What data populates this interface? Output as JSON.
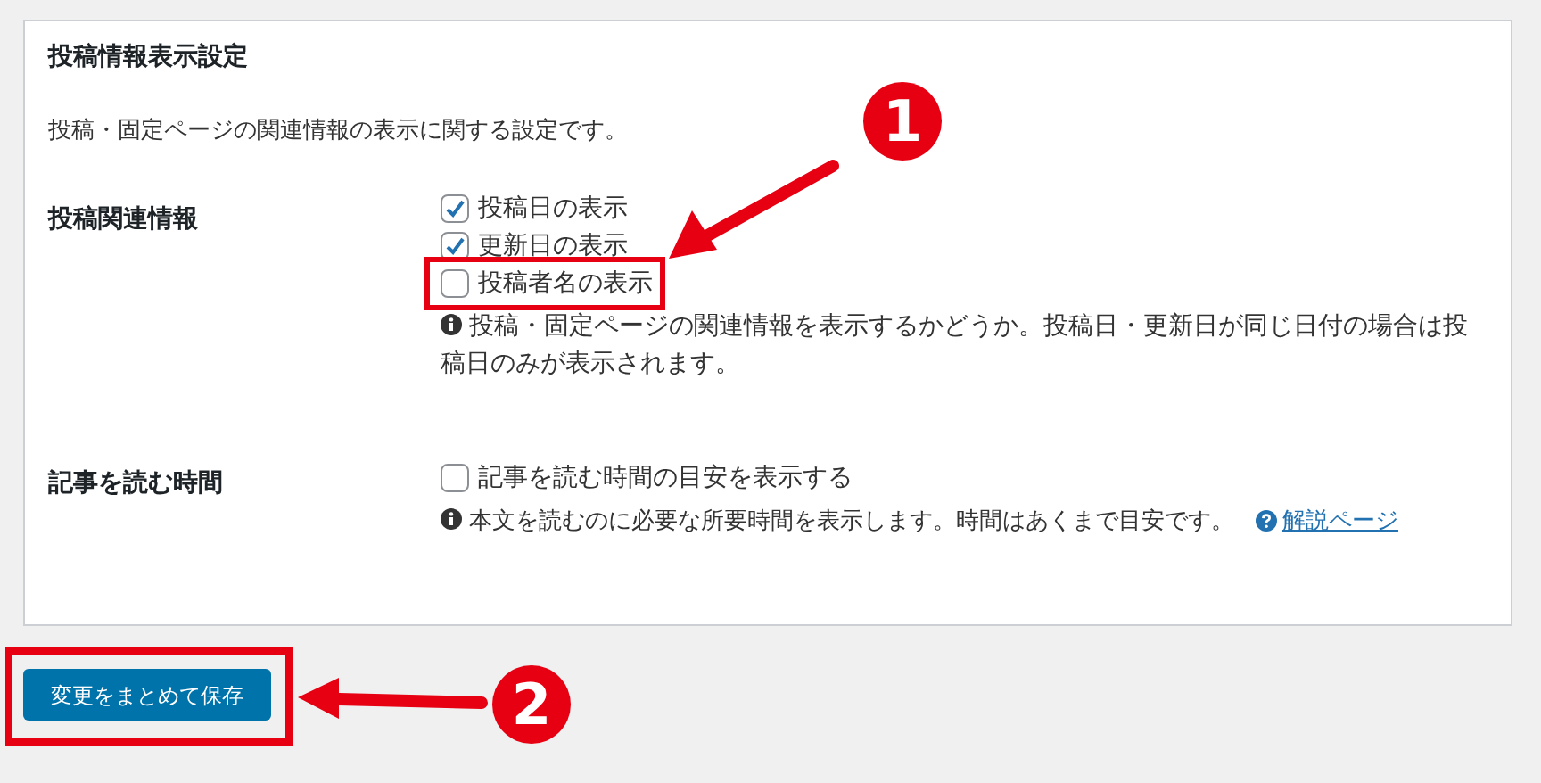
{
  "panel": {
    "title": "投稿情報表示設定",
    "description": "投稿・固定ページの関連情報の表示に関する設定です。"
  },
  "settings": [
    {
      "label": "投稿関連情報",
      "options": [
        {
          "label": "投稿日の表示",
          "checked": true
        },
        {
          "label": "更新日の表示",
          "checked": true
        },
        {
          "label": "投稿者名の表示",
          "checked": false
        }
      ],
      "help": "投稿・固定ページの関連情報を表示するかどうか。投稿日・更新日が同じ日付の場合は投稿日のみが表示されます。"
    },
    {
      "label": "記事を読む時間",
      "options": [
        {
          "label": "記事を読む時間の目安を表示する",
          "checked": false
        }
      ],
      "help": "本文を読むのに必要な所要時間を表示します。時間はあくまで目安です。",
      "link": "解説ページ"
    }
  ],
  "save_button": "変更をまとめて保存",
  "annotations": [
    {
      "number": "1"
    },
    {
      "number": "2"
    }
  ]
}
